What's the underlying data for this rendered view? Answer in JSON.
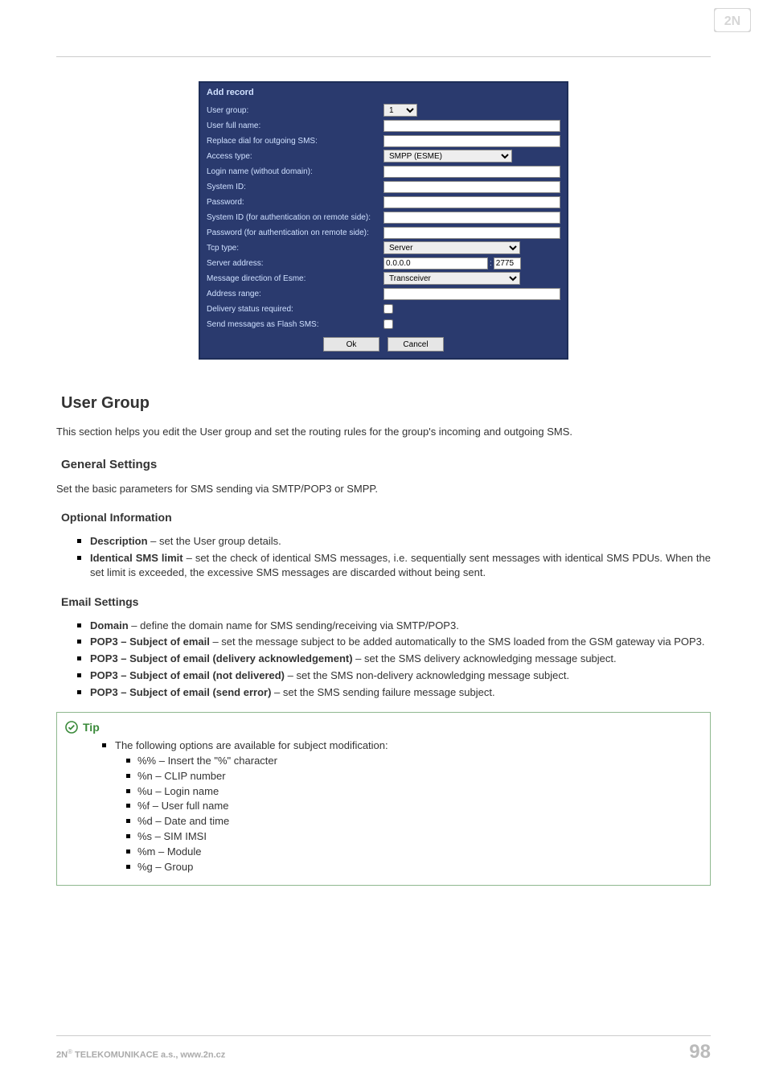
{
  "logo_alt": "2N",
  "dialog": {
    "title": "Add record",
    "rows": {
      "user_group": "User group:",
      "user_full_name": "User full name:",
      "replace_dial": "Replace dial for outgoing SMS:",
      "access_type": "Access type:",
      "login_name": "Login name (without domain):",
      "system_id": "System ID:",
      "password": "Password:",
      "system_id_remote": "System ID (for authentication on remote side):",
      "password_remote": "Password (for authentication on remote side):",
      "tcp_type": "Tcp type:",
      "server_address": "Server address:",
      "msg_dir": "Message direction of Esme:",
      "addr_range": "Address range:",
      "delivery_status": "Delivery status required:",
      "flash_sms": "Send messages as Flash SMS:"
    },
    "values": {
      "user_group_val": "1",
      "access_type_val": "SMPP (ESME)",
      "tcp_type_val": "Server",
      "server_addr_val": "0.0.0.0",
      "server_port_val": "2775",
      "msg_dir_val": "Transceiver"
    },
    "buttons": {
      "ok": "Ok",
      "cancel": "Cancel"
    }
  },
  "sections": {
    "user_group_h": "User Group",
    "user_group_p": "This section helps you edit the User group and set the routing rules for the group's incoming and outgoing SMS.",
    "general_h": "General Settings",
    "general_p": "Set the basic parameters for SMS sending via SMTP/POP3 or SMPP.",
    "optional_h": "Optional Information",
    "optional_items": [
      {
        "b": "Description",
        "t": " – set the User group details."
      },
      {
        "b": "Identical SMS limit",
        "t": " – set the check of identical SMS messages, i.e. sequentially sent messages with identical SMS PDUs. When the set limit is exceeded, the excessive SMS messages are discarded without being sent."
      }
    ],
    "email_h": "Email Settings",
    "email_items": [
      {
        "b": "Domain",
        "t": " – define the domain name for SMS sending/receiving via SMTP/POP3."
      },
      {
        "b": "POP3 – Subject of email",
        "t": " – set the message subject to be added automatically to the SMS loaded from the GSM gateway via POP3."
      },
      {
        "b": "POP3 – Subject of email (delivery acknowledgement)",
        "t": " – set the SMS delivery acknowledging message subject."
      },
      {
        "b": "POP3 – Subject of email (not delivered)",
        "t": " – set the SMS non-delivery acknowledging message subject."
      },
      {
        "b": "POP3 – Subject of email (send error)",
        "t": " – set the SMS sending failure message subject."
      }
    ]
  },
  "tip": {
    "label": "Tip",
    "intro": "The following options are available for subject modification:",
    "items": [
      "%% – Insert the \"%\" character",
      "%n – CLIP number",
      "%u – Login name",
      "%f – User full name",
      "%d – Date and time",
      "%s – SIM IMSI",
      "%m – Module",
      "%g – Group"
    ]
  },
  "footer": {
    "company_prefix": "2N",
    "company_reg": "®",
    "company_rest": " TELEKOMUNIKACE a.s., www.2n.cz",
    "page": "98"
  }
}
